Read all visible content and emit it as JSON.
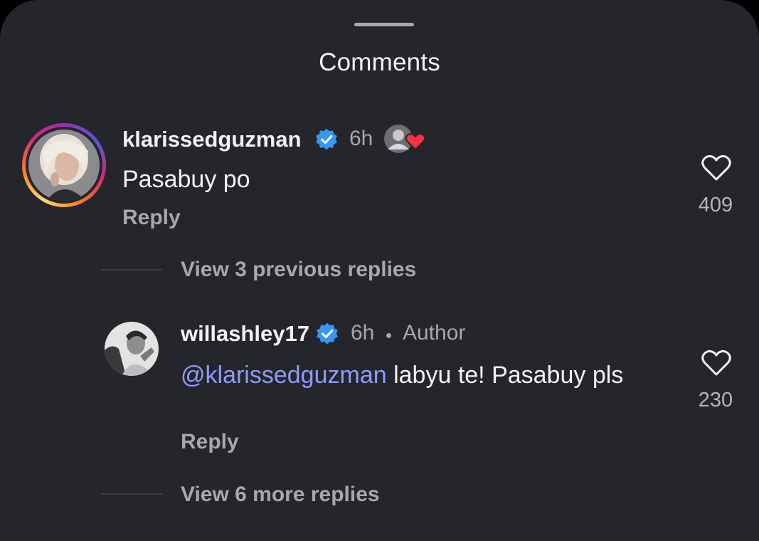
{
  "sheet": {
    "title": "Comments"
  },
  "comments": [
    {
      "username": "klarissedguzman",
      "verified": true,
      "time": "6h",
      "text": "Pasabuy po",
      "reply_label": "Reply",
      "likes": "409",
      "liked_by_author": true
    }
  ],
  "thread": {
    "previous_replies_label": "View 3 previous replies",
    "more_replies_label": "View 6 more replies"
  },
  "replies": [
    {
      "username": "willashley17",
      "verified": true,
      "time": "6h",
      "badge": "Author",
      "mention": "@klarissedguzman",
      "text": " labyu te! Pasabuy pls",
      "reply_label": "Reply",
      "likes": "230"
    }
  ],
  "colors": {
    "background": "#25262b",
    "text": "#f2f2f2",
    "muted": "#a6a8ad",
    "mention": "#8f9bff",
    "verified": "#3897f0",
    "heart": "#ff3040"
  },
  "icons": {
    "verified": "verified-badge-icon",
    "like": "heart-outline-icon",
    "liked_by_author": "author-liked-heart-icon"
  }
}
